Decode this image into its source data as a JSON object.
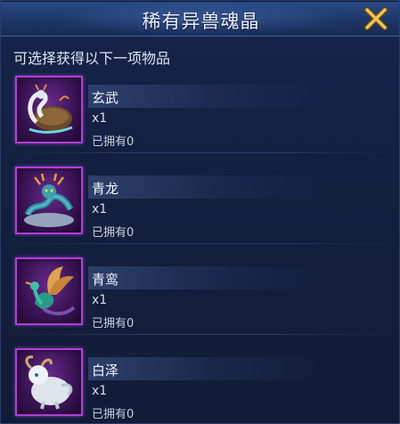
{
  "dialog": {
    "title": "稀有异兽魂晶",
    "close_icon": "close-x-icon",
    "subtitle": "可选择获得以下一项物品"
  },
  "items": [
    {
      "name": "玄武",
      "quantity": "x1",
      "owned": "已拥有0",
      "icon": "xuanwu-beast-icon"
    },
    {
      "name": "青龙",
      "quantity": "x1",
      "owned": "已拥有0",
      "icon": "qinglong-dragon-icon"
    },
    {
      "name": "青鸾",
      "quantity": "x1",
      "owned": "已拥有0",
      "icon": "qingluan-bird-icon"
    },
    {
      "name": "白泽",
      "quantity": "x1",
      "owned": "已拥有0",
      "icon": "baize-beast-icon"
    }
  ],
  "colors": {
    "background": "#13203f",
    "titlebar": "#1d3566",
    "rarity_border": "#b53cd9",
    "close_icon": "#e8b94a"
  }
}
